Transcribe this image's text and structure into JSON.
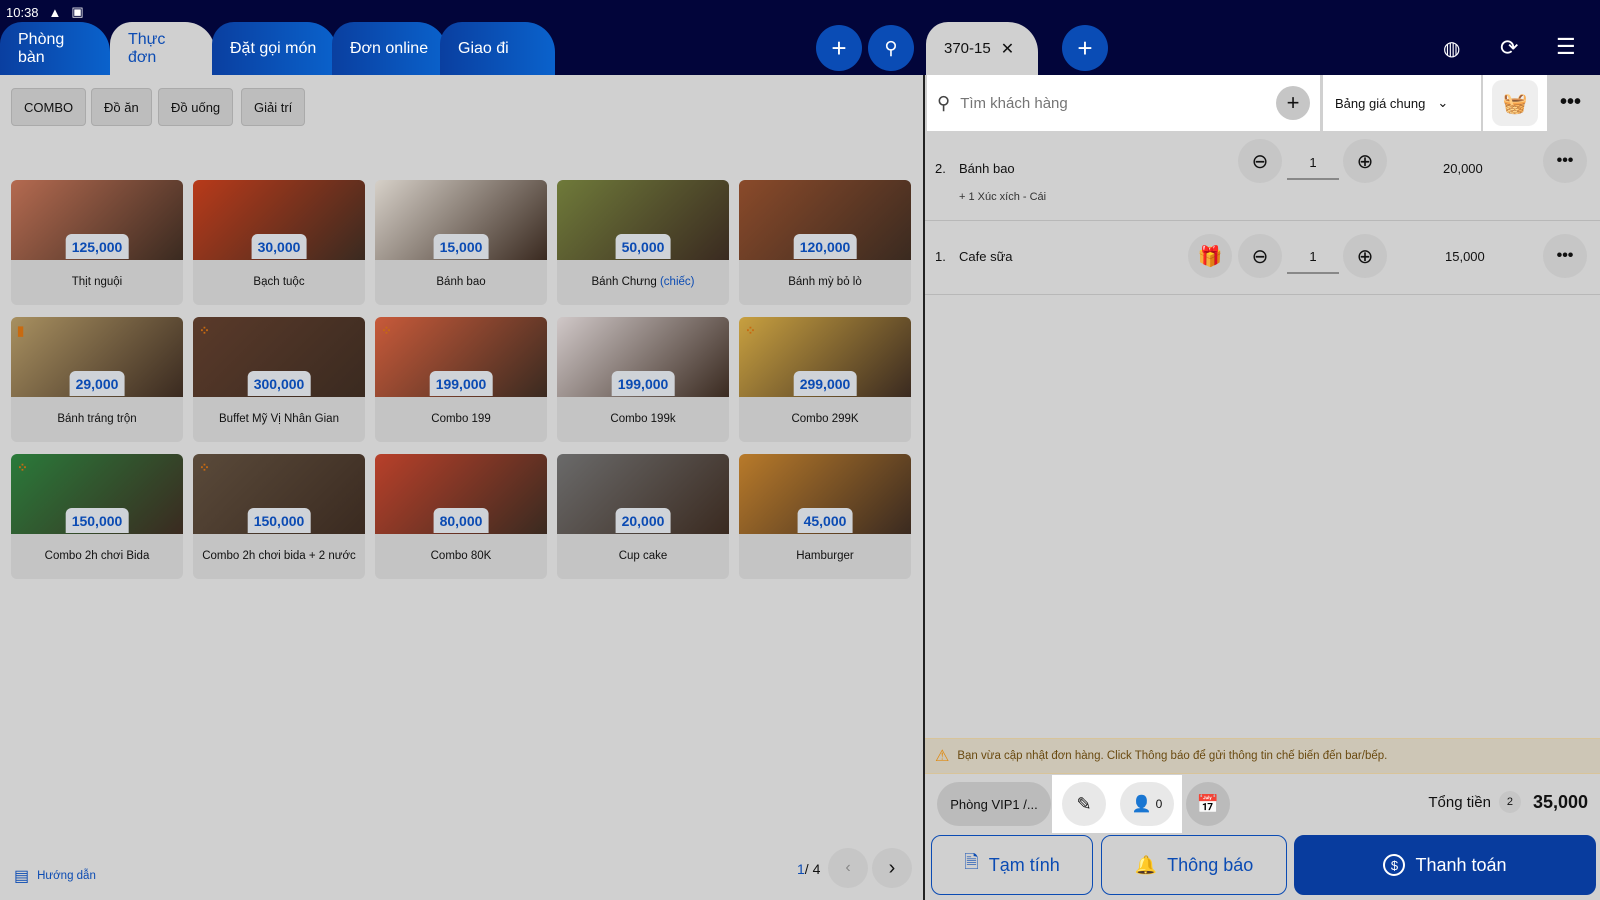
{
  "status": {
    "time": "10:38"
  },
  "tabs": [
    {
      "label": "Phòng bàn"
    },
    {
      "label": "Thực đơn",
      "active": true
    },
    {
      "label": "Đặt gọi món"
    },
    {
      "label": "Đơn online"
    },
    {
      "label": "Giao đi"
    }
  ],
  "categories": [
    "COMBO",
    "Đồ ăn",
    "Đồ uống",
    "Giải trí"
  ],
  "products": [
    {
      "name": "Thịt nguội",
      "price": "125,000",
      "color": "#b46a50"
    },
    {
      "name": "Bạch tuộc",
      "price": "30,000",
      "color": "#b83a1a"
    },
    {
      "name": "Bánh bao",
      "price": "15,000",
      "color": "#d6d0c8"
    },
    {
      "name": "Bánh Chưng",
      "suffix": "(chiếc)",
      "price": "50,000",
      "color": "#6f7a3a"
    },
    {
      "name": "Bánh mỳ bỏ lò",
      "price": "120,000",
      "color": "#8a4a2a"
    },
    {
      "name": "Bánh tráng trộn",
      "price": "29,000",
      "color": "#a89060",
      "badge": "▮"
    },
    {
      "name": "Buffet Mỹ Vị Nhân Gian",
      "price": "300,000",
      "color": "#5a3a2a",
      "badge": "⁘"
    },
    {
      "name": "Combo 199",
      "price": "199,000",
      "color": "#c85a3a",
      "badge": "⁘"
    },
    {
      "name": "Combo 199k",
      "price": "199,000",
      "color": "#d0c8c8"
    },
    {
      "name": "Combo 299K",
      "price": "299,000",
      "color": "#c8a040",
      "badge": "⁘"
    },
    {
      "name": "Combo 2h chơi Bida",
      "price": "150,000",
      "color": "#2a7a3a",
      "badge": "⁘"
    },
    {
      "name": "Combo 2h chơi bida + 2 nước",
      "price": "150,000",
      "color": "#5a4a3a",
      "badge": "⁘"
    },
    {
      "name": "Combo 80K",
      "price": "80,000",
      "color": "#b8402a"
    },
    {
      "name": "Cup cake",
      "price": "20,000",
      "color": "#6a6a6a"
    },
    {
      "name": "Hamburger",
      "price": "45,000",
      "color": "#b87a2a"
    }
  ],
  "footer": {
    "guide": "Hướng dẫn",
    "page_current": "1",
    "page_total": "/ 4"
  },
  "order": {
    "tab": "370-15",
    "search_placeholder": "Tìm khách hàng",
    "price_list": "Bảng giá chung",
    "items": [
      {
        "index": "2.",
        "name": "Bánh bao",
        "qty": "1",
        "price": "20,000",
        "note": "+ 1 Xúc xích - Cái"
      },
      {
        "index": "1.",
        "name": "Cafe sữa",
        "qty": "1",
        "price": "15,000"
      }
    ],
    "warning": "Bạn vừa cập nhật đơn hàng. Click Thông báo để gửi thông tin chế biến đến bar/bếp.",
    "room": "Phòng VIP1 /...",
    "guests": "0",
    "total_label": "Tổng tiền",
    "total_count": "2",
    "total": "35,000",
    "btn_provisional": "Tạm tính",
    "btn_notify": "Thông báo",
    "btn_pay": "Thanh toán"
  },
  "colors": {
    "accent": "#0b4bb3",
    "topbar": "#02053a"
  }
}
